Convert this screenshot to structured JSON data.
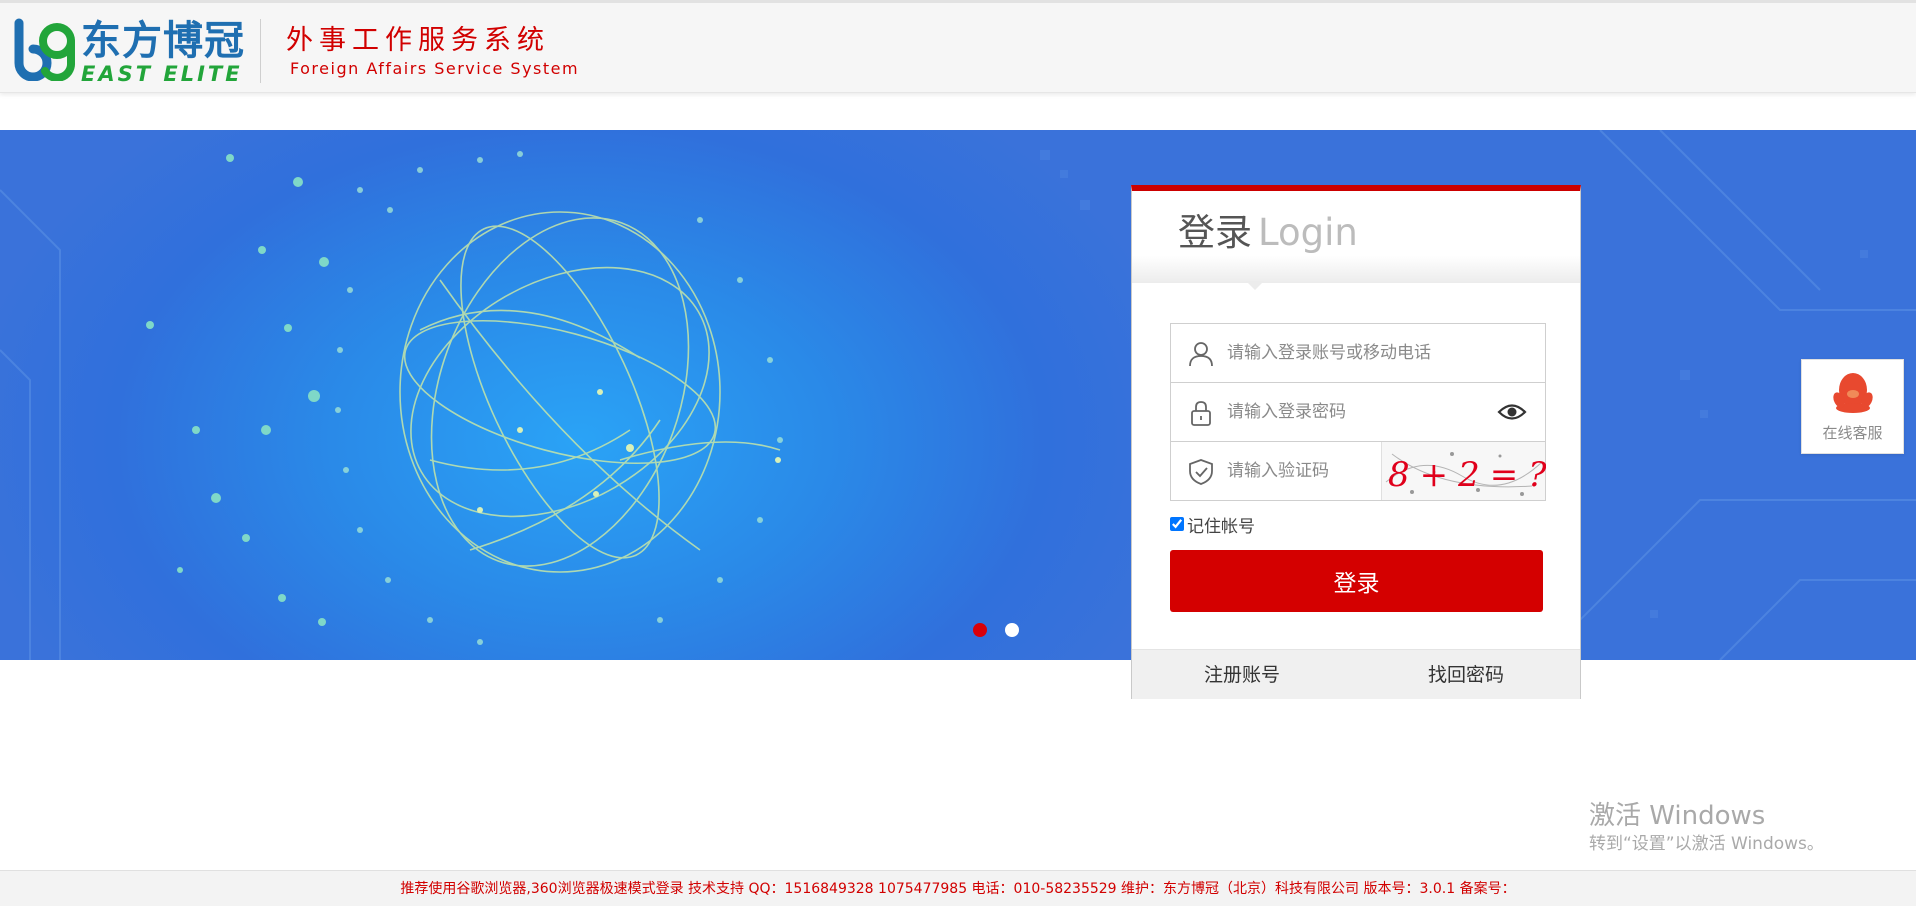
{
  "header": {
    "logo_cn": "东方博冠",
    "logo_en": "EAST ELITE",
    "system_title_cn": "外事工作服务系统",
    "system_title_en": "Foreign Affairs Service System"
  },
  "login": {
    "title_cn": "登录",
    "title_en": "Login",
    "account_placeholder": "请输入登录账号或移动电话",
    "password_placeholder": "请输入登录密码",
    "captcha_placeholder": "请输入验证码",
    "captcha_text": "8+2=?",
    "remember_label": "记住帐号",
    "remember_checked": true,
    "submit_label": "登录",
    "register_link": "注册账号",
    "recover_link": "找回密码"
  },
  "carousel": {
    "slides": 2,
    "active_index": 0
  },
  "service": {
    "label": "在线客服"
  },
  "watermark": {
    "title": "激活 Windows",
    "subtitle": "转到“设置”以激活 Windows。"
  },
  "footer": {
    "text": "推荐使用谷歌浏览器,360浏览器极速模式登录    技术支持 QQ：1516849328 1075477985 电话：010-58235529    维护：东方博冠（北京）科技有限公司    版本号：3.0.1    备案号："
  },
  "colors": {
    "brand_red": "#d40000",
    "banner_blue": "#2a8ae8",
    "logo_blue": "#1f6fb1",
    "logo_green": "#22a53a"
  },
  "icons": {
    "account": "user-icon",
    "password": "lock-icon",
    "captcha": "shield-check-icon",
    "toggle_password": "eye-icon",
    "service": "qq-penguin-icon"
  }
}
